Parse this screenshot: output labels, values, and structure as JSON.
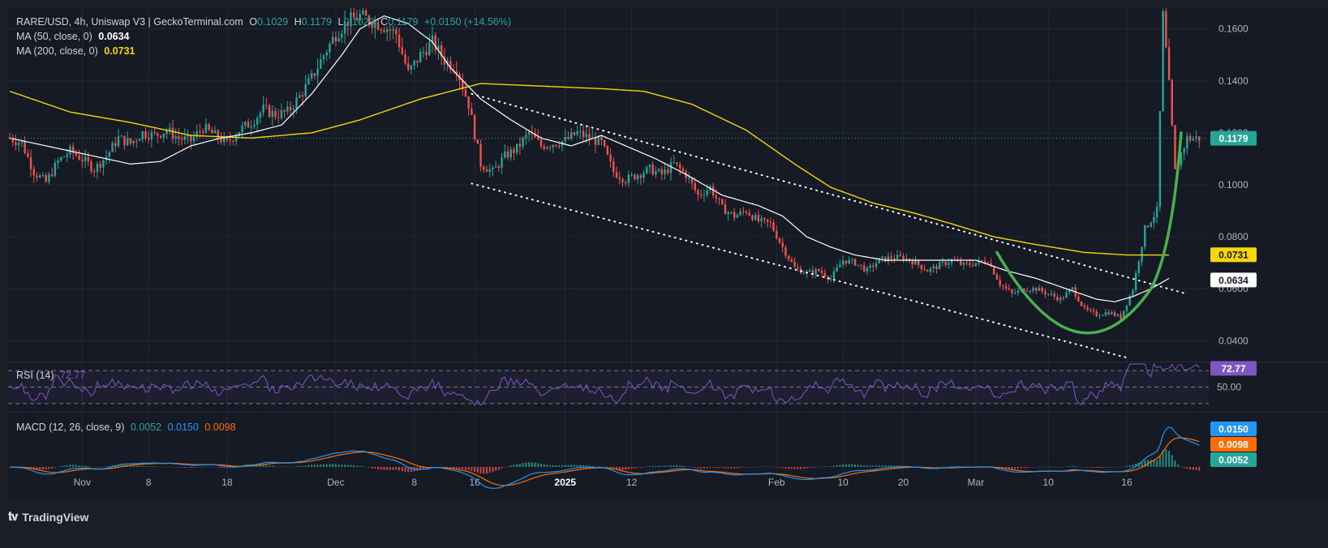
{
  "header": {
    "symbol": "RARE/USD, 4h, Uniswap V3 | GeckoTerminal.com",
    "o_label": "O",
    "o_value": "0.1029",
    "h_label": "H",
    "h_value": "0.1179",
    "l_label": "L",
    "l_value": "0.1029",
    "c_label": "C",
    "c_value": "0.1179",
    "change": "+0.0150 (+14.56%)"
  },
  "indicators": {
    "ma50_label": "MA (50, close, 0)",
    "ma50_value": "0.0634",
    "ma200_label": "MA (200, close, 0)",
    "ma200_value": "0.0731",
    "rsi_label": "RSI (14)",
    "rsi_value": "72.77",
    "macd_label": "MACD (12, 26, close, 9)",
    "macd_v1": "0.0052",
    "macd_v2": "0.0150",
    "macd_v3": "0.0098"
  },
  "footer": {
    "brand": "TradingView"
  },
  "colors": {
    "bg": "#161a25",
    "grid": "#232834",
    "up": "#26a69a",
    "down": "#ef5350",
    "ma50": "#ffffff",
    "ma200": "#f5d60a",
    "rsi": "#7e57c2",
    "macd": "#2196f3",
    "signal": "#ff6d00",
    "pattern": "#4caf50"
  },
  "chart_data": [
    {
      "type": "candlestick",
      "title": "RARE/USD, 4h, Uniswap V3",
      "x_ticks": [
        "Nov",
        "8",
        "18",
        "Dec",
        "8",
        "16",
        "2025",
        "12",
        "Feb",
        "10",
        "20",
        "Mar",
        "10",
        "16"
      ],
      "y_ticks": [
        "0.1600",
        "0.1400",
        "0.1200",
        "0.1000",
        "0.0800",
        "0.0600",
        "0.0400"
      ],
      "ylim": [
        0.032,
        0.168
      ],
      "last_price_label": "0.1179",
      "ma200_label": "0.0731",
      "ma50_label": "0.0634",
      "close_path": [
        [
          0,
          0.118
        ],
        [
          4,
          0.116
        ],
        [
          8,
          0.105
        ],
        [
          12,
          0.101
        ],
        [
          16,
          0.109
        ],
        [
          20,
          0.113
        ],
        [
          24,
          0.11
        ],
        [
          28,
          0.106
        ],
        [
          32,
          0.111
        ],
        [
          36,
          0.118
        ],
        [
          40,
          0.116
        ],
        [
          44,
          0.12
        ],
        [
          48,
          0.119
        ],
        [
          52,
          0.121
        ],
        [
          56,
          0.118
        ],
        [
          60,
          0.117
        ],
        [
          64,
          0.122
        ],
        [
          68,
          0.119
        ],
        [
          72,
          0.116
        ],
        [
          76,
          0.121
        ],
        [
          80,
          0.124
        ],
        [
          84,
          0.129
        ],
        [
          88,
          0.127
        ],
        [
          92,
          0.128
        ],
        [
          96,
          0.134
        ],
        [
          100,
          0.141
        ],
        [
          104,
          0.15
        ],
        [
          108,
          0.158
        ],
        [
          112,
          0.163
        ],
        [
          116,
          0.165
        ],
        [
          120,
          0.163
        ],
        [
          124,
          0.161
        ],
        [
          128,
          0.158
        ],
        [
          132,
          0.143
        ],
        [
          136,
          0.15
        ],
        [
          140,
          0.155
        ],
        [
          144,
          0.148
        ],
        [
          148,
          0.145
        ],
        [
          152,
          0.131
        ],
        [
          156,
          0.108
        ],
        [
          160,
          0.105
        ],
        [
          164,
          0.111
        ],
        [
          168,
          0.114
        ],
        [
          172,
          0.12
        ],
        [
          176,
          0.115
        ],
        [
          180,
          0.116
        ],
        [
          184,
          0.117
        ],
        [
          188,
          0.12
        ],
        [
          192,
          0.118
        ],
        [
          196,
          0.116
        ],
        [
          200,
          0.105
        ],
        [
          204,
          0.102
        ],
        [
          208,
          0.104
        ],
        [
          212,
          0.106
        ],
        [
          216,
          0.104
        ],
        [
          220,
          0.108
        ],
        [
          224,
          0.104
        ],
        [
          228,
          0.096
        ],
        [
          232,
          0.099
        ],
        [
          236,
          0.091
        ],
        [
          240,
          0.088
        ],
        [
          244,
          0.09
        ],
        [
          248,
          0.086
        ],
        [
          252,
          0.085
        ],
        [
          256,
          0.076
        ],
        [
          260,
          0.068
        ],
        [
          264,
          0.066
        ],
        [
          268,
          0.067
        ],
        [
          272,
          0.064
        ],
        [
          276,
          0.071
        ],
        [
          280,
          0.07
        ],
        [
          284,
          0.067
        ],
        [
          288,
          0.071
        ],
        [
          292,
          0.072
        ],
        [
          296,
          0.072
        ],
        [
          300,
          0.07
        ],
        [
          304,
          0.067
        ],
        [
          308,
          0.069
        ],
        [
          312,
          0.071
        ],
        [
          316,
          0.069
        ],
        [
          320,
          0.07
        ],
        [
          324,
          0.071
        ],
        [
          328,
          0.062
        ],
        [
          332,
          0.058
        ],
        [
          336,
          0.06
        ],
        [
          340,
          0.06
        ],
        [
          344,
          0.058
        ],
        [
          348,
          0.056
        ],
        [
          352,
          0.06
        ],
        [
          356,
          0.052
        ],
        [
          360,
          0.05
        ],
        [
          364,
          0.051
        ],
        [
          368,
          0.049
        ],
        [
          372,
          0.06
        ],
        [
          376,
          0.083
        ],
        [
          380,
          0.09
        ],
        [
          382,
          0.165
        ],
        [
          384,
          0.138
        ],
        [
          386,
          0.105
        ],
        [
          388,
          0.112
        ],
        [
          390,
          0.1179
        ]
      ],
      "ma50_path": [
        [
          0,
          0.118
        ],
        [
          20,
          0.113
        ],
        [
          40,
          0.108
        ],
        [
          50,
          0.109
        ],
        [
          60,
          0.115
        ],
        [
          70,
          0.118
        ],
        [
          80,
          0.12
        ],
        [
          90,
          0.123
        ],
        [
          100,
          0.135
        ],
        [
          110,
          0.15
        ],
        [
          116,
          0.16
        ],
        [
          124,
          0.165
        ],
        [
          132,
          0.162
        ],
        [
          140,
          0.155
        ],
        [
          146,
          0.145
        ],
        [
          156,
          0.133
        ],
        [
          166,
          0.125
        ],
        [
          176,
          0.118
        ],
        [
          186,
          0.115
        ],
        [
          196,
          0.119
        ],
        [
          204,
          0.115
        ],
        [
          214,
          0.11
        ],
        [
          224,
          0.104
        ],
        [
          236,
          0.096
        ],
        [
          248,
          0.092
        ],
        [
          256,
          0.088
        ],
        [
          264,
          0.08
        ],
        [
          272,
          0.076
        ],
        [
          280,
          0.073
        ],
        [
          290,
          0.071
        ],
        [
          300,
          0.071
        ],
        [
          310,
          0.071
        ],
        [
          320,
          0.071
        ],
        [
          330,
          0.067
        ],
        [
          340,
          0.064
        ],
        [
          350,
          0.06
        ],
        [
          360,
          0.056
        ],
        [
          366,
          0.055
        ],
        [
          372,
          0.057
        ],
        [
          378,
          0.06
        ],
        [
          384,
          0.064
        ]
      ],
      "ma200_path": [
        [
          0,
          0.136
        ],
        [
          20,
          0.128
        ],
        [
          40,
          0.124
        ],
        [
          60,
          0.119
        ],
        [
          80,
          0.118
        ],
        [
          100,
          0.12
        ],
        [
          116,
          0.125
        ],
        [
          136,
          0.133
        ],
        [
          156,
          0.139
        ],
        [
          176,
          0.138
        ],
        [
          196,
          0.137
        ],
        [
          210,
          0.136
        ],
        [
          226,
          0.131
        ],
        [
          244,
          0.121
        ],
        [
          260,
          0.108
        ],
        [
          272,
          0.099
        ],
        [
          286,
          0.093
        ],
        [
          300,
          0.089
        ],
        [
          312,
          0.085
        ],
        [
          326,
          0.08
        ],
        [
          340,
          0.077
        ],
        [
          356,
          0.074
        ],
        [
          370,
          0.073
        ],
        [
          384,
          0.073
        ]
      ],
      "channel_upper": [
        [
          153,
          0.135
        ],
        [
          390,
          0.058
        ]
      ],
      "channel_lower": [
        [
          153,
          0.1005
        ],
        [
          370,
          0.0335
        ]
      ],
      "bottom_arc": [
        [
          327,
          0.074
        ],
        [
          358,
          0.042
        ],
        [
          378,
          0.06
        ],
        [
          388,
          0.12
        ]
      ]
    },
    {
      "type": "line",
      "title": "RSI (14)",
      "levels": [
        70,
        50,
        30
      ],
      "level_label": "50.00",
      "last_value_label": "72.77",
      "ylim": [
        20,
        80
      ]
    },
    {
      "type": "line",
      "title": "MACD (12, 26, close, 9)",
      "series": [
        {
          "name": "0.0150",
          "color": "#2196f3"
        },
        {
          "name": "0.0098",
          "color": "#ff6d00"
        },
        {
          "name": "0.0052",
          "color": "#26a69a"
        }
      ],
      "value_labels": [
        "0.0150",
        "0.0098",
        "0.0052"
      ]
    }
  ]
}
